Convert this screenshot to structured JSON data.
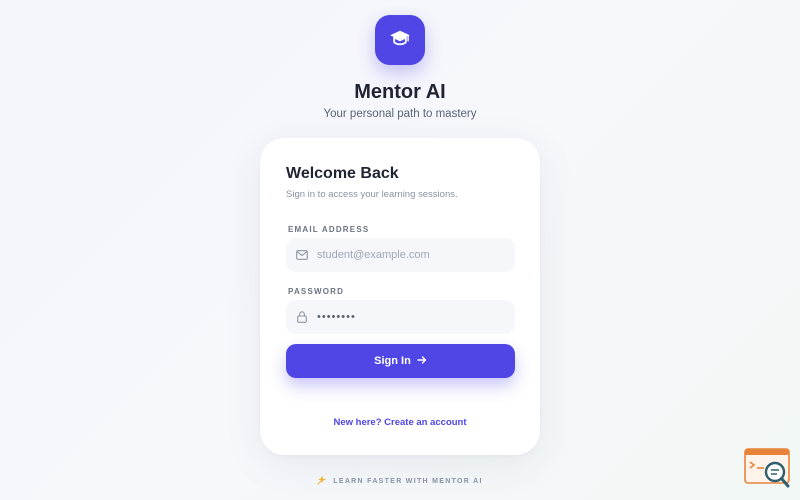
{
  "brand": {
    "logo_icon": "graduation-cap-icon",
    "name": "Mentor AI",
    "tagline": "Your personal path to mastery"
  },
  "login": {
    "title": "Welcome Back",
    "subtitle": "Sign in to access your learning sessions.",
    "email": {
      "label": "EMAIL ADDRESS",
      "placeholder": "student@example.com",
      "value": "",
      "icon": "mail-icon"
    },
    "password": {
      "label": "PASSWORD",
      "masked_value": "••••••••",
      "icon": "lock-icon"
    },
    "submit_label": "Sign In",
    "submit_icon": "arrow-right-icon",
    "create_account_link": "New here? Create an account"
  },
  "footer": {
    "icon": "sparkle-icon",
    "text": "LEARN FASTER WITH MENTOR AI"
  },
  "colors": {
    "accent": "#4f46e5",
    "badge_orange": "#e8833a",
    "badge_teal": "#2f5f6e"
  }
}
